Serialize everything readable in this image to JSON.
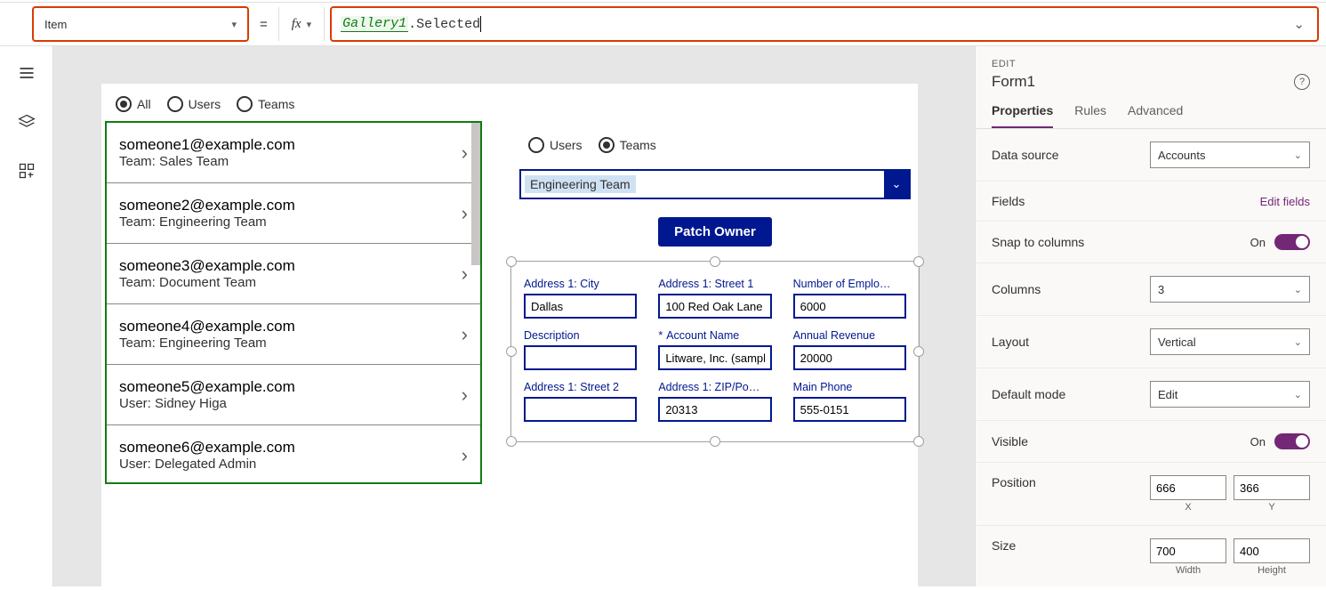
{
  "formula": {
    "property": "Item",
    "fx_label": "fx",
    "token_ref": "Gallery1",
    "token_prop": ".Selected"
  },
  "canvas": {
    "filter_radios": {
      "all": "All",
      "users": "Users",
      "teams": "Teams",
      "selected": "all"
    },
    "gallery": [
      {
        "title": "someone1@example.com",
        "sub": "Team: Sales Team"
      },
      {
        "title": "someone2@example.com",
        "sub": "Team: Engineering Team"
      },
      {
        "title": "someone3@example.com",
        "sub": "Team: Document Team"
      },
      {
        "title": "someone4@example.com",
        "sub": "Team: Engineering Team"
      },
      {
        "title": "someone5@example.com",
        "sub": "User: Sidney Higa"
      },
      {
        "title": "someone6@example.com",
        "sub": "User: Delegated Admin"
      }
    ],
    "detail": {
      "radios": {
        "users": "Users",
        "teams": "Teams",
        "selected": "teams"
      },
      "combo_value": "Engineering Team",
      "patch_btn": "Patch Owner",
      "form_fields": [
        {
          "label": "Address 1: City",
          "value": "Dallas"
        },
        {
          "label": "Address 1: Street 1",
          "value": "100 Red Oak Lane"
        },
        {
          "label": "Number of Emplo…",
          "value": "6000"
        },
        {
          "label": "Description",
          "value": ""
        },
        {
          "label": "Account Name",
          "value": "Litware, Inc. (sample",
          "required": true
        },
        {
          "label": "Annual Revenue",
          "value": "20000"
        },
        {
          "label": "Address 1: Street 2",
          "value": ""
        },
        {
          "label": "Address 1: ZIP/Po…",
          "value": "20313"
        },
        {
          "label": "Main Phone",
          "value": "555-0151"
        }
      ]
    }
  },
  "props": {
    "eyebrow": "EDIT",
    "title": "Form1",
    "tabs": {
      "properties": "Properties",
      "rules": "Rules",
      "advanced": "Advanced"
    },
    "data_source_label": "Data source",
    "data_source_value": "Accounts",
    "fields_label": "Fields",
    "edit_fields": "Edit fields",
    "snap_label": "Snap to columns",
    "snap_value": "On",
    "columns_label": "Columns",
    "columns_value": "3",
    "layout_label": "Layout",
    "layout_value": "Vertical",
    "default_mode_label": "Default mode",
    "default_mode_value": "Edit",
    "visible_label": "Visible",
    "visible_value": "On",
    "position_label": "Position",
    "position_x": "666",
    "position_y": "366",
    "position_x_cap": "X",
    "position_y_cap": "Y",
    "size_label": "Size",
    "size_w": "700",
    "size_h": "400",
    "size_w_cap": "Width",
    "size_h_cap": "Height"
  }
}
